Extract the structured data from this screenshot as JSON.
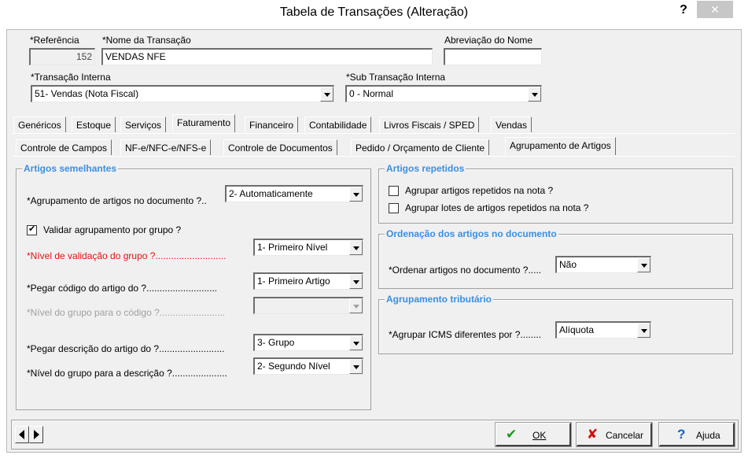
{
  "window": {
    "title": "Tabela de Transações (Alteração)",
    "help_glyph": "?",
    "close_glyph": "✕"
  },
  "header": {
    "referencia_label": "*Referência",
    "referencia_value": "152",
    "nome_label": "*Nome da Transação",
    "nome_value": "VENDAS NFE",
    "abrev_label": "Abreviação do Nome",
    "abrev_value": "",
    "transacao_label": "*Transação Interna",
    "transacao_value": "51- Vendas (Nota Fiscal)",
    "subtransacao_label": "*Sub Transação Interna",
    "subtransacao_value": "0 - Normal"
  },
  "tabs_main": [
    "Genéricos",
    "Estoque",
    "Serviços",
    "Faturamento",
    "Financeiro",
    "Contabilidade",
    "Livros Fiscais / SPED",
    "Vendas"
  ],
  "tabs_sub": [
    "Controle de Campos",
    "NF-e/NFC-e/NFS-e",
    "Controle de Documentos",
    "Pedido / Orçamento de Cliente",
    "Agrupamento de Artigos"
  ],
  "left_group": {
    "title": "Artigos semelhantes",
    "agrup_label": "*Agrupamento de artigos no documento ?..",
    "agrup_value": "2- Automaticamente",
    "validar_label": "Validar agrupamento por grupo ?",
    "nivel_valid_label": "*Nível de validação do grupo ?...........................",
    "nivel_valid_value": "1- Primeiro Nível",
    "pegar_codigo_label": "*Pegar código do artigo do ?...........................",
    "pegar_codigo_value": "1- Primeiro Artigo",
    "nivel_codigo_label": "*Nível do grupo para o código ?.........................",
    "nivel_codigo_value": "",
    "pegar_desc_label": "*Pegar descrição do artigo do ?.........................",
    "pegar_desc_value": "3- Grupo",
    "nivel_desc_label": "*Nível do grupo para a descrição ?.....................",
    "nivel_desc_value": "2- Segundo Nível"
  },
  "repetidos": {
    "title": "Artigos repetidos",
    "opt1": "Agrupar artigos repetidos na nota ?",
    "opt2": "Agrupar lotes de artigos repetidos na nota ?"
  },
  "ordenacao": {
    "title": "Ordenação dos artigos no documento",
    "label": "*Ordenar artigos no documento ?.....",
    "value": "Não"
  },
  "tributario": {
    "title": "Agrupamento tributário",
    "label": "*Agrupar ICMS diferentes por ?........",
    "value": "Alíquota"
  },
  "footer": {
    "ok_label": "OK",
    "cancel_label": "Cancelar",
    "help_label": "Ajuda"
  },
  "colors": {
    "group_title": "#3b8fe0",
    "required_red": "#e81010",
    "disabled": "#a0a0a0"
  }
}
